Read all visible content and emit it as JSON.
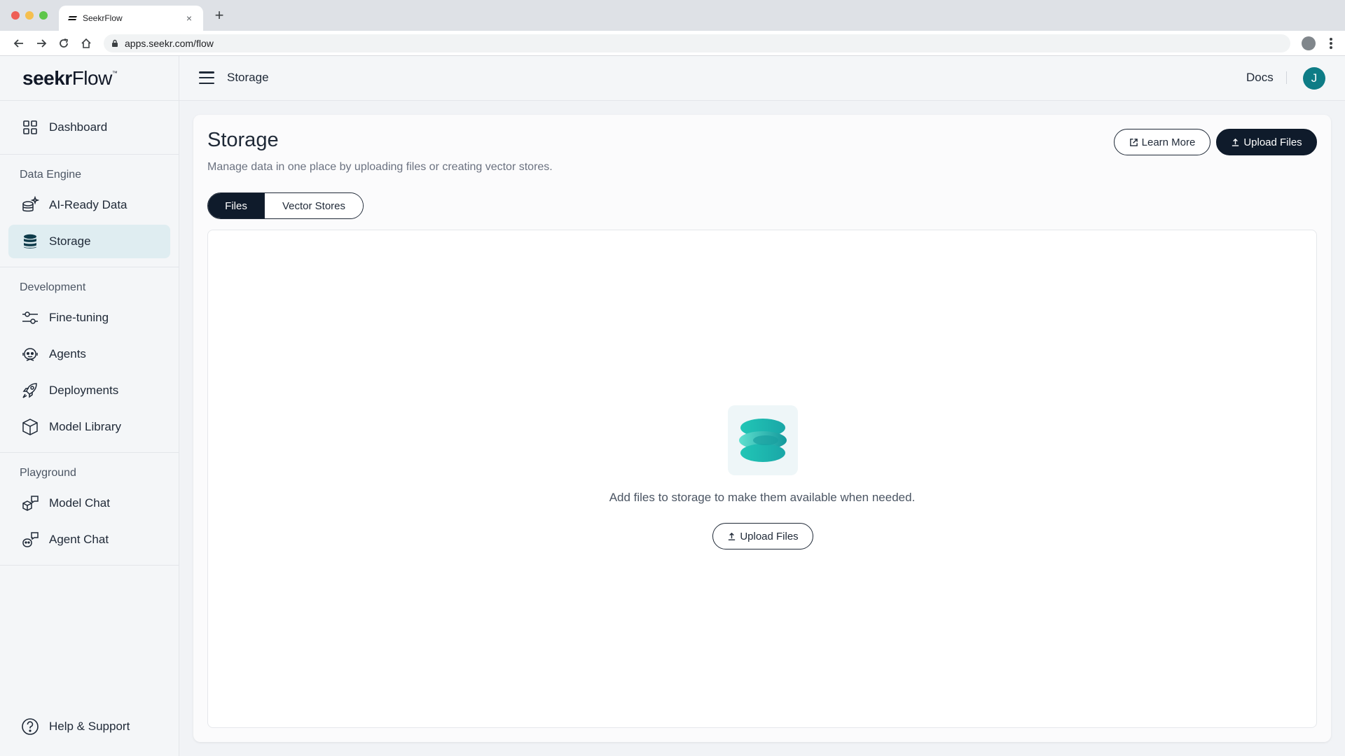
{
  "browser": {
    "tab_title": "SeekrFlow",
    "tab_close": "×",
    "new_tab": "+",
    "url": "apps.seekr.com/flow"
  },
  "logo": {
    "part1": "seekr",
    "part2": "Flow",
    "mark": "™"
  },
  "sidebar": {
    "dashboard": "Dashboard",
    "sections": [
      {
        "heading": "Data Engine",
        "items": [
          {
            "label": "AI-Ready Data"
          },
          {
            "label": "Storage"
          }
        ]
      },
      {
        "heading": "Development",
        "items": [
          {
            "label": "Fine-tuning"
          },
          {
            "label": "Agents"
          },
          {
            "label": "Deployments"
          },
          {
            "label": "Model Library"
          }
        ]
      },
      {
        "heading": "Playground",
        "items": [
          {
            "label": "Model Chat"
          },
          {
            "label": "Agent Chat"
          }
        ]
      }
    ],
    "help": "Help & Support",
    "active_item": "Storage"
  },
  "topbar": {
    "title": "Storage",
    "docs": "Docs",
    "avatar_initial": "J"
  },
  "page": {
    "title": "Storage",
    "subtitle": "Manage data in one place by uploading files or creating vector stores.",
    "learn_more": "Learn More",
    "upload_files": "Upload Files",
    "tabs": [
      {
        "label": "Files",
        "selected": true
      },
      {
        "label": "Vector Stores",
        "selected": false
      }
    ],
    "empty_message": "Add files to storage to make them available when needed.",
    "empty_upload": "Upload Files"
  },
  "colors": {
    "accent": "#0e7c86",
    "dark_button": "#0f1b2b",
    "active_nav": "#dfedf1",
    "storage_gradient_start": "#1fc7b7",
    "storage_gradient_end": "#1aa3a3"
  }
}
